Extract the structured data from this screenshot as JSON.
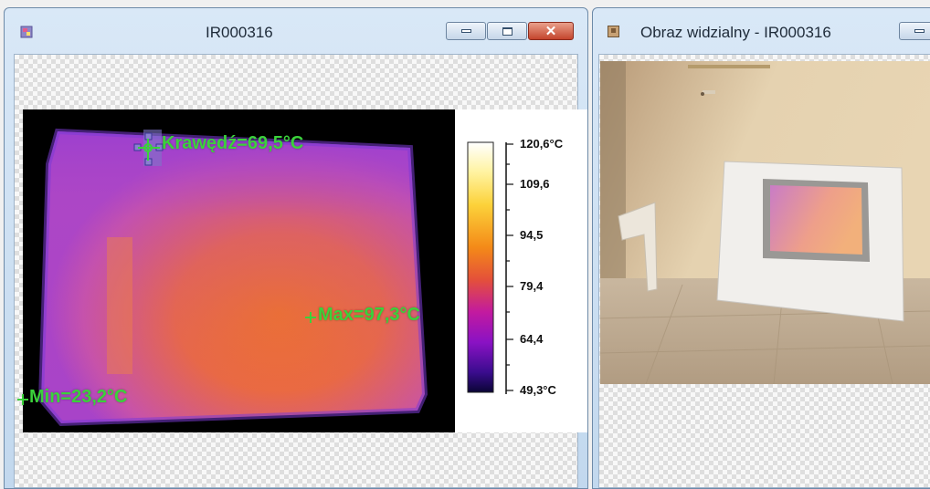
{
  "thermal_window": {
    "title": "IR000316",
    "buttons": {
      "minimize": "minimize",
      "maximize": "maximize",
      "close": "close"
    },
    "markers": [
      {
        "id": "edge",
        "label": "Krawędź=69,5°C"
      },
      {
        "id": "max",
        "label": "Max=97,3°C"
      },
      {
        "id": "min",
        "label": "Min=23,2°C"
      }
    ],
    "scale": {
      "labels": [
        "120,6°C",
        "109,6",
        "94,5",
        "79,4",
        "64,4",
        "49,3°C"
      ]
    }
  },
  "visible_window": {
    "title": "Obraz widzialny - IR000316"
  },
  "colors": {
    "marker_green": "#3bd13b",
    "title_bar": "#c9dcf0",
    "close_button": "#c4452d"
  }
}
